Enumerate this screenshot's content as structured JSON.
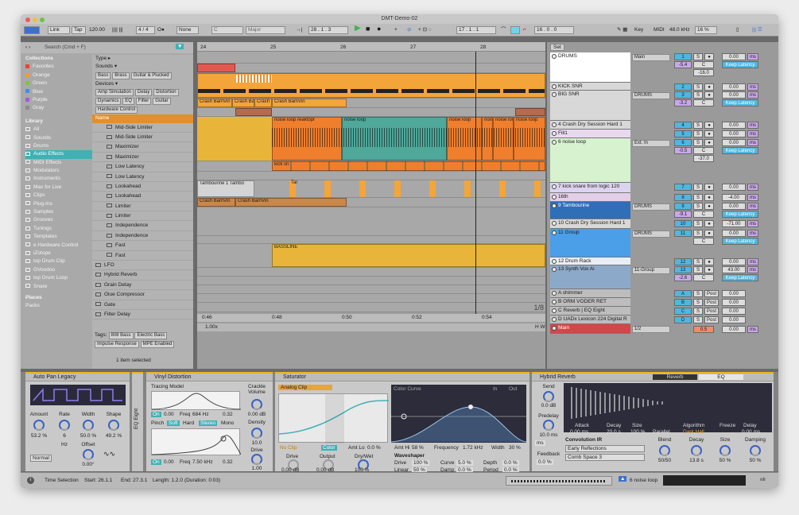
{
  "window": {
    "title": "DMT-Demo-02"
  },
  "transport": {
    "link": "Link",
    "tap": "Tap",
    "tempo": "120.00",
    "signature": "4 / 4",
    "quantize": "None",
    "key": "C",
    "scale": "Major",
    "arrangement_pos": "28 .  1 .  3",
    "loop_start": "17 .  1 .  1",
    "loop_length": "16 .  0 .  0",
    "key_label": "Key",
    "midi_label": "MIDI",
    "sample_rate": "48.0 kHz",
    "cpu": "16 %"
  },
  "browser": {
    "search_placeholder": "Search (Cmd + F)",
    "collections_title": "Collections",
    "collections": [
      {
        "label": "Favorites",
        "color": "#e8472f"
      },
      {
        "label": "Orange",
        "color": "#f29a2c"
      },
      {
        "label": "Green",
        "color": "#7cc24a"
      },
      {
        "label": "Blue",
        "color": "#3f8ee8"
      },
      {
        "label": "Purple",
        "color": "#a15cd6"
      },
      {
        "label": "Gray",
        "color": "#8c8c8c"
      }
    ],
    "library_title": "Library",
    "library": [
      "All",
      "Sounds",
      "Drums",
      "Audio Effects",
      "MIDI Effects",
      "Modulators",
      "Instruments",
      "Max for Live",
      "Clips",
      "Plug-Ins",
      "Samples",
      "Grooves",
      "Tunings",
      "Templates",
      "e Hardware Control",
      "iZotope",
      "top Drum Clip",
      "GVoodoo",
      "top Drum Loop",
      "Snare"
    ],
    "places_title": "Places",
    "places": [
      "Packs"
    ],
    "filters": {
      "type_label": "Type",
      "sounds_label": "Sounds",
      "sounds_tags": [
        "Bass",
        "Brass",
        "Guitar & Plucked"
      ],
      "devices_label": "Devices",
      "devices_tags": [
        "Amp Simulation",
        "Delay",
        "Distortion",
        "Dynamics",
        "EQ",
        "Filter",
        "Guitar",
        "Hardware Control"
      ]
    },
    "name_header": "Name",
    "results": [
      "Mid-Side Limiter",
      "Mid-Side Limiter",
      "Maximizer",
      "Maximizer",
      "Low Latency",
      "Low Latency",
      "Lookahead",
      "Lookahead",
      "Limiter",
      "Limiter",
      "Independence",
      "Independence",
      "Fast",
      "Fast",
      "LFO",
      "Hybrid Reverb",
      "Grain Delay",
      "Glue Compressor",
      "Gate",
      "Filter Delay"
    ],
    "tags_label": "Tags:",
    "tags": [
      "808 Bass",
      "Electric Bass",
      "Impulse Response",
      "MPE Enabled"
    ],
    "selected_count": "1 item selected"
  },
  "arrangement": {
    "bars": [
      "24",
      "25",
      "26",
      "27",
      "28"
    ],
    "time_marks": [
      "0:46",
      "0:48",
      "0:50",
      "0:52",
      "0:54"
    ],
    "clips": [
      {
        "label": "Crash BamVin"
      },
      {
        "label": "Crash BamVin"
      },
      {
        "label": "Crash BamVin"
      },
      {
        "label": "Crash BamVin"
      },
      {
        "label": "noise loop reaktopr"
      },
      {
        "label": "noise loop"
      },
      {
        "label": "noise loop"
      },
      {
        "label": "noise loop"
      },
      {
        "label": "noise loop"
      },
      {
        "label": "noise loop"
      },
      {
        "label": "kick sn"
      },
      {
        "label": "Tambourine 1 Tambo"
      },
      {
        "label": "Tar"
      },
      {
        "label": "Crash BamVin"
      },
      {
        "label": "Crash BamVin"
      },
      {
        "label": "BASSLINE"
      }
    ],
    "locator": "1/8",
    "zoom": "1.00x"
  },
  "mixer": {
    "set_label": "Set",
    "tracks": [
      {
        "name": "DRUMS",
        "num": "1",
        "vol": "-5.4",
        "pan": "C",
        "send": "-16.0",
        "color": "#ffffff",
        "io": "Main",
        "db": "0.00",
        "ms": "ms",
        "extra": "Keep Latency"
      },
      {
        "name": "KICK SNR",
        "num": "2",
        "color": "#d8d8d8",
        "db": "0.00",
        "ms": "ms"
      },
      {
        "name": "BIG SNR",
        "num": "3",
        "vol": "-3.2",
        "pan": "C",
        "color": "#d8d8d8",
        "io": "DRUMS",
        "db": "0.00",
        "ms": "ms",
        "extra": "Keep Latency"
      },
      {
        "name": "4 Crash Dry Session Hard 1",
        "num": "4",
        "color": "#d8d8d8",
        "db": "0.00",
        "ms": "ms"
      },
      {
        "name": "Fill1",
        "num": "5",
        "color": "#e9d9ef",
        "db": "0.00",
        "ms": "ms"
      },
      {
        "name": "6 noise loop",
        "num": "6",
        "vol": "-0.5",
        "pan": "C",
        "send": "-37.0",
        "color": "#d6f2cf",
        "io": "Ext. In",
        "db": "0.00",
        "ms": "ms",
        "extra": "Keep Latency"
      },
      {
        "name": "7 kick snare from logic 120",
        "num": "7",
        "color": "#dcd4ef",
        "db": "0.00",
        "ms": "ms"
      },
      {
        "name": "16th",
        "num": "8",
        "color": "#e3cfe8",
        "db": "-4.00",
        "ms": "ms"
      },
      {
        "name": "9 Tambourine",
        "num": "9",
        "vol": "-9.1",
        "pan": "C",
        "color": "#2f6fb8",
        "io": "DRUMS",
        "db": "0.00",
        "ms": "ms",
        "extra": "Keep Latency"
      },
      {
        "name": "10 Crash Dry Session Hard 1",
        "num": "10",
        "color": "#d8d8d8",
        "db": "-71.00",
        "ms": "ms"
      },
      {
        "name": "11 Group",
        "num": "11",
        "pan": "C",
        "color": "#4b9ee8",
        "io": "DRUMS",
        "db": "0.00",
        "ms": "ms",
        "extra": "Keep Latency"
      },
      {
        "name": "12 Drum Rack",
        "num": "12",
        "color": "#e8eef8",
        "db": "0.00",
        "ms": "ms"
      },
      {
        "name": "13 Synth Vox Ai",
        "num": "13",
        "vol": "-2.6",
        "pan": "C",
        "color": "#8da9c9",
        "io": "11-Group",
        "db": "43.00",
        "ms": "ms",
        "extra": "Keep Latency"
      }
    ],
    "returns": [
      {
        "name": "A shimmer",
        "num": "A",
        "db": "0.00",
        "post": "Post"
      },
      {
        "name": "B ORM VODER RET",
        "num": "B",
        "db": "0.00",
        "post": "Post"
      },
      {
        "name": "C Reverb | EQ Eight",
        "num": "C",
        "db": "0.00",
        "post": "Post"
      },
      {
        "name": "D UADx Lexicon 224 Digital R",
        "num": "D",
        "db": "0.00",
        "post": "Post"
      }
    ],
    "master": {
      "name": "Main",
      "ratio": "1/2",
      "vol": "0.5",
      "db": "0.00",
      "ms": "ms"
    },
    "io_options": {
      "in": "In",
      "auto": "Auto",
      "off": "Off"
    }
  },
  "devices": {
    "auto_pan": {
      "title": "Auto Pan Legacy",
      "amount_label": "Amount",
      "amount": "53.2 %",
      "rate_label": "Rate",
      "rate": "6",
      "width_label": "Width",
      "width": "50.0 %",
      "shape_label": "Shape",
      "shape": "49.2 %",
      "offset_label": "Offset",
      "offset": "0.00°",
      "mode": "Normal",
      "hz": "Hz"
    },
    "eq_label": "EQ Eight",
    "vinyl": {
      "title": "Vinyl Distortion",
      "tracing_label": "Tracing Model",
      "on": "On",
      "drive": "0.00",
      "freq_label": "Freq",
      "freq": "684 Hz",
      "q": "0.32",
      "pinch_label": "Pinch",
      "soft": "Soft",
      "hard": "Hard",
      "stereo": "Stereo",
      "mono": "Mono",
      "drive2": "0.00",
      "freq2": "7.50 kHz",
      "q2": "0.32",
      "crackle_label": "Crackle Volume",
      "crackle": "0.00 dB",
      "density_label": "Density",
      "density": "10.0",
      "drive_label": "Drive",
      "drive_val": "1.00"
    },
    "saturator": {
      "title": "Saturator",
      "mode": "Analog Clip",
      "no_clip": "No Clip",
      "color_btn": "Color",
      "amt_lo": "Amt Lo",
      "amt_lo_val": "0.0 %",
      "curve_label": "Color Curve",
      "in": "In",
      "out": "Out",
      "amt_hi": "Amt Hi",
      "amt_hi_val": "58 %",
      "freq": "Frequency",
      "freq_val": "1.72 kHz",
      "width": "Width",
      "width_val": "30 %",
      "drive_label": "Drive",
      "drive": "0.00 dB",
      "output_label": "Output",
      "output": "0.00 dB",
      "drywet_label": "Dry/Wet",
      "drywet": "100 %",
      "waveshaper": "Waveshaper",
      "ws_drive": "Drive",
      "ws_drive_v": "100 %",
      "ws_curve": "Curve",
      "ws_curve_v": "5.0 %",
      "ws_depth": "Depth",
      "ws_depth_v": "0.0 %",
      "ws_linear": "Linear",
      "ws_linear_v": "50 %",
      "ws_damp": "Damp",
      "ws_damp_v": "0.0 %",
      "ws_period": "Period",
      "ws_period_v": "0.0 %"
    },
    "reverb": {
      "title": "Hybrid Reverb",
      "tab_reverb": "Reverb",
      "tab_eq": "EQ",
      "send_label": "Send",
      "send": "0.0 dB",
      "predelay_label": "Predelay",
      "predelay": "10.0 ms",
      "ms": "ms",
      "feedback_label": "Feedback",
      "feedback": "0.0 %",
      "attack_label": "Attack",
      "attack": "0.00 ms",
      "decay_label": "Decay",
      "decay": "20.0 s",
      "size_label": "Size",
      "size": "100 %",
      "parallel": "Parallel",
      "algorithm_label": "Algorithm",
      "algorithm": "Dark Hall",
      "freeze_label": "Freeze",
      "delay_label": "Delay",
      "delay": "0.00 ms",
      "conv_label": "Convolution IR",
      "ir1": "Early Reflections",
      "ir2": "Comb Space 3",
      "blend_label": "Blend",
      "blend": "50/50",
      "decay2_label": "Decay",
      "decay2": "13.8 s",
      "size2_label": "Size",
      "size2": "50 %",
      "damping_label": "Damping",
      "damping": "50 %"
    }
  },
  "status": {
    "mode": "Time Selection",
    "start": "Start: 26.1.1",
    "end": "End: 27.3.1",
    "length": "Length: 1.2.0",
    "duration": "(Duration: 0:03)",
    "track": "6 noise loop"
  }
}
